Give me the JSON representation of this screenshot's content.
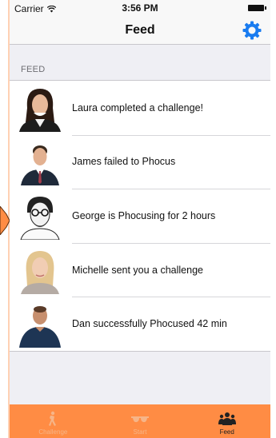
{
  "status_bar": {
    "carrier": "Carrier",
    "time": "3:56 PM"
  },
  "nav": {
    "title": "Feed",
    "settings_icon": "gear-icon"
  },
  "section": {
    "header": "FEED"
  },
  "feed": [
    {
      "text": "Laura completed a challenge!",
      "avatar": "woman-dark-hair-avatar"
    },
    {
      "text": "James failed to Phocus",
      "avatar": "man-suit-avatar"
    },
    {
      "text": "George is Phocusing for 2 hours",
      "avatar": "man-glasses-sketch-avatar"
    },
    {
      "text": "Michelle sent you a challenge",
      "avatar": "woman-blonde-avatar"
    },
    {
      "text": "Dan successfully Phocused 42 min",
      "avatar": "man-bald-avatar"
    }
  ],
  "tabs": [
    {
      "label": "Challenge",
      "icon": "walking-person-icon",
      "active": false
    },
    {
      "label": "Start",
      "icon": "sunglasses-icon",
      "active": false
    },
    {
      "label": "Feed",
      "icon": "group-people-icon",
      "active": true
    }
  ],
  "colors": {
    "accent": "#ff8c44",
    "settings_blue": "#1a7cf0"
  }
}
